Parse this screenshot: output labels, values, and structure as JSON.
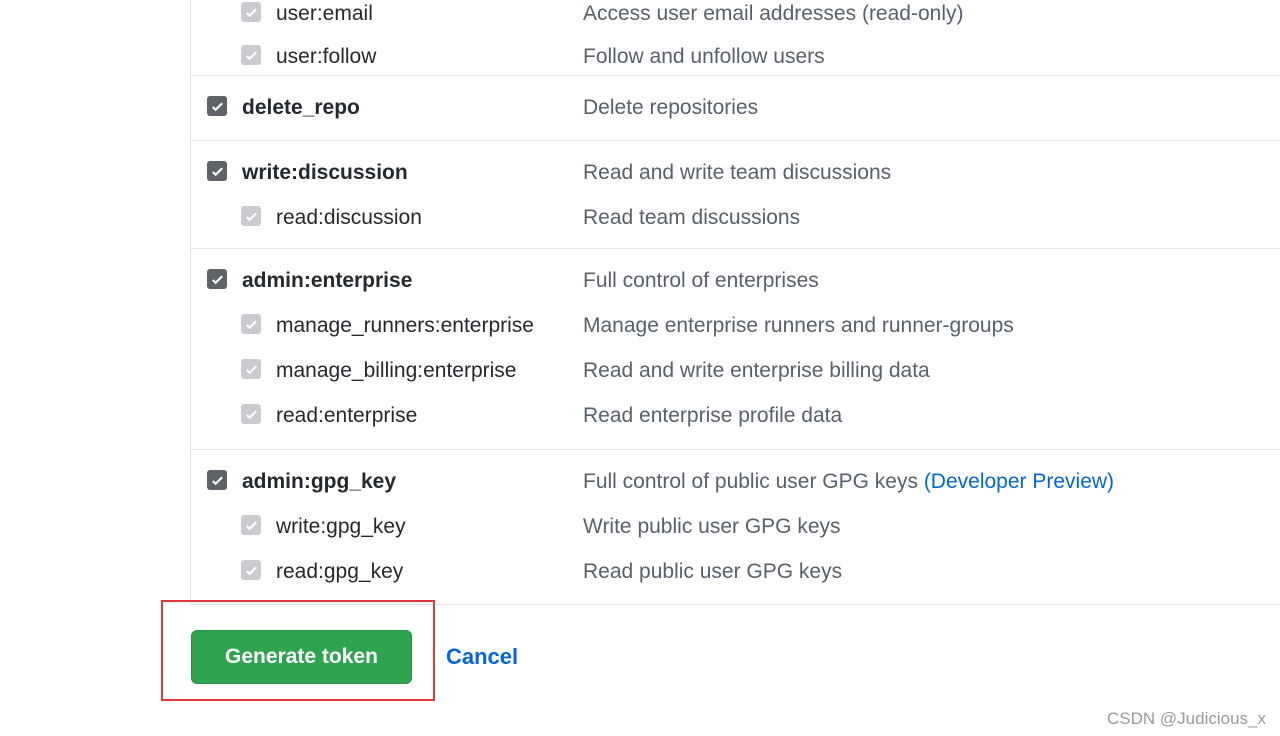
{
  "scopes": [
    {
      "items": [
        {
          "name": "user:email",
          "description": "Access user email addresses (read-only)",
          "level": "child",
          "checked": true
        },
        {
          "name": "user:follow",
          "description": "Follow and unfollow users",
          "level": "child",
          "checked": true
        }
      ]
    },
    {
      "items": [
        {
          "name": "delete_repo",
          "description": "Delete repositories",
          "level": "parent",
          "checked": true
        }
      ]
    },
    {
      "items": [
        {
          "name": "write:discussion",
          "description": "Read and write team discussions",
          "level": "parent",
          "checked": true
        },
        {
          "name": "read:discussion",
          "description": "Read team discussions",
          "level": "child",
          "checked": true
        }
      ]
    },
    {
      "items": [
        {
          "name": "admin:enterprise",
          "description": "Full control of enterprises",
          "level": "parent",
          "checked": true
        },
        {
          "name": "manage_runners:enterprise",
          "description": "Manage enterprise runners and runner-groups",
          "level": "child",
          "checked": true
        },
        {
          "name": "manage_billing:enterprise",
          "description": "Read and write enterprise billing data",
          "level": "child",
          "checked": true
        },
        {
          "name": "read:enterprise",
          "description": "Read enterprise profile data",
          "level": "child",
          "checked": true
        }
      ]
    },
    {
      "items": [
        {
          "name": "admin:gpg_key",
          "description": "Full control of public user GPG keys",
          "link": "(Developer Preview)",
          "level": "parent",
          "checked": true
        },
        {
          "name": "write:gpg_key",
          "description": "Write public user GPG keys",
          "level": "child",
          "checked": true
        },
        {
          "name": "read:gpg_key",
          "description": "Read public user GPG keys",
          "level": "child",
          "checked": true
        }
      ]
    }
  ],
  "actions": {
    "generate_label": "Generate token",
    "cancel_label": "Cancel"
  },
  "watermark": "CSDN @Judicious_x",
  "colors": {
    "primary_button": "#2ea44f",
    "link": "#0366d6",
    "highlight_border": "#e5383b"
  }
}
